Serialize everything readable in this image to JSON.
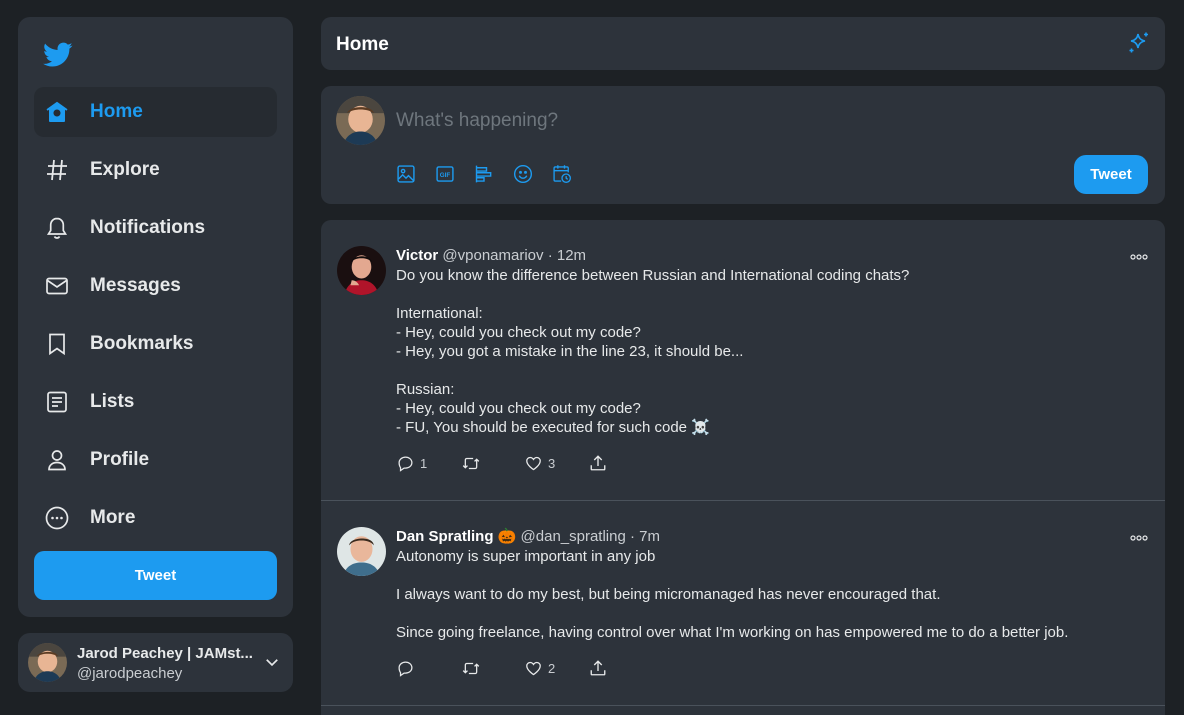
{
  "sidebar": {
    "logo_icon": "twitter-bird-icon",
    "items": [
      {
        "label": "Home",
        "icon": "home-icon",
        "active": true
      },
      {
        "label": "Explore",
        "icon": "hashtag-icon"
      },
      {
        "label": "Notifications",
        "icon": "bell-icon"
      },
      {
        "label": "Messages",
        "icon": "envelope-icon"
      },
      {
        "label": "Bookmarks",
        "icon": "bookmark-icon"
      },
      {
        "label": "Lists",
        "icon": "list-icon"
      },
      {
        "label": "Profile",
        "icon": "person-icon"
      },
      {
        "label": "More",
        "icon": "more-circle-icon"
      }
    ],
    "tweet_button": "Tweet"
  },
  "account": {
    "name": "Jarod Peachey | JAMst...",
    "handle": "@jarodpeachey"
  },
  "header": {
    "title": "Home",
    "icon": "sparkle-icon"
  },
  "composer": {
    "placeholder": "What's happening?",
    "tools": [
      "image-icon",
      "gif-icon",
      "poll-icon",
      "emoji-icon",
      "schedule-icon"
    ],
    "tweet_button": "Tweet"
  },
  "tweets": [
    {
      "name": "Victor",
      "handle": "@vponamariov",
      "time": "· 12m",
      "lines": [
        "Do you know the difference between Russian and International coding chats?",
        "",
        "International:",
        "- Hey, could you check out my code?",
        "- Hey, you got a mistake in the line 23, it should be...",
        "",
        "Russian:",
        "- Hey, could you check out my code?",
        "- FU, You should be executed for such code ☠️"
      ],
      "replies": "1",
      "retweets": "",
      "likes": "3"
    },
    {
      "name": "Dan Spratling 🎃",
      "handle": "@dan_spratling",
      "time": "· 7m",
      "lines": [
        "Autonomy is super important in any job",
        "",
        "I always want to do my best, but being micromanaged has never encouraged that.",
        "",
        "Since going freelance, having control over what I'm working on has empowered me to do a better job."
      ],
      "replies": "",
      "retweets": "",
      "likes": "2"
    }
  ],
  "colors": {
    "accent": "#1d9bf0",
    "panel": "#2d333b",
    "background": "#1d2125"
  }
}
